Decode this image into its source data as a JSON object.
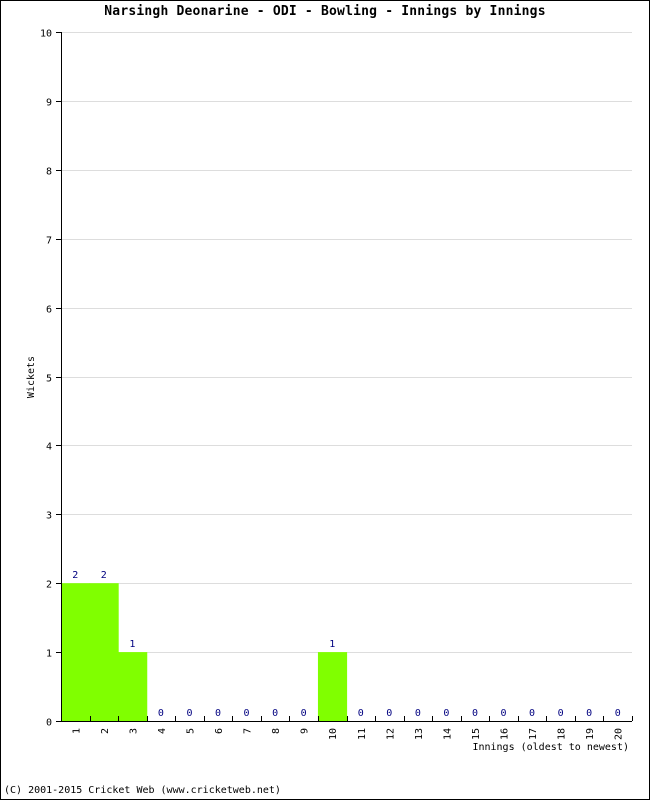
{
  "chart_data": {
    "type": "bar",
    "title": "Narsingh Deonarine - ODI - Bowling - Innings by Innings",
    "xlabel": "Innings (oldest to newest)",
    "ylabel": "Wickets",
    "categories": [
      "1",
      "2",
      "3",
      "4",
      "5",
      "6",
      "7",
      "8",
      "9",
      "10",
      "11",
      "12",
      "13",
      "14",
      "15",
      "16",
      "17",
      "18",
      "19",
      "20"
    ],
    "values": [
      2,
      2,
      1,
      0,
      0,
      0,
      0,
      0,
      0,
      1,
      0,
      0,
      0,
      0,
      0,
      0,
      0,
      0,
      0,
      0
    ],
    "ylim": [
      0,
      10
    ],
    "yticks": [
      0,
      1,
      2,
      3,
      4,
      5,
      6,
      7,
      8,
      9,
      10
    ],
    "grid": true,
    "bar_color": "#80ff00",
    "label_color": "#000080",
    "grid_color": "#dddddd"
  },
  "footer": "(C) 2001-2015 Cricket Web (www.cricketweb.net)"
}
